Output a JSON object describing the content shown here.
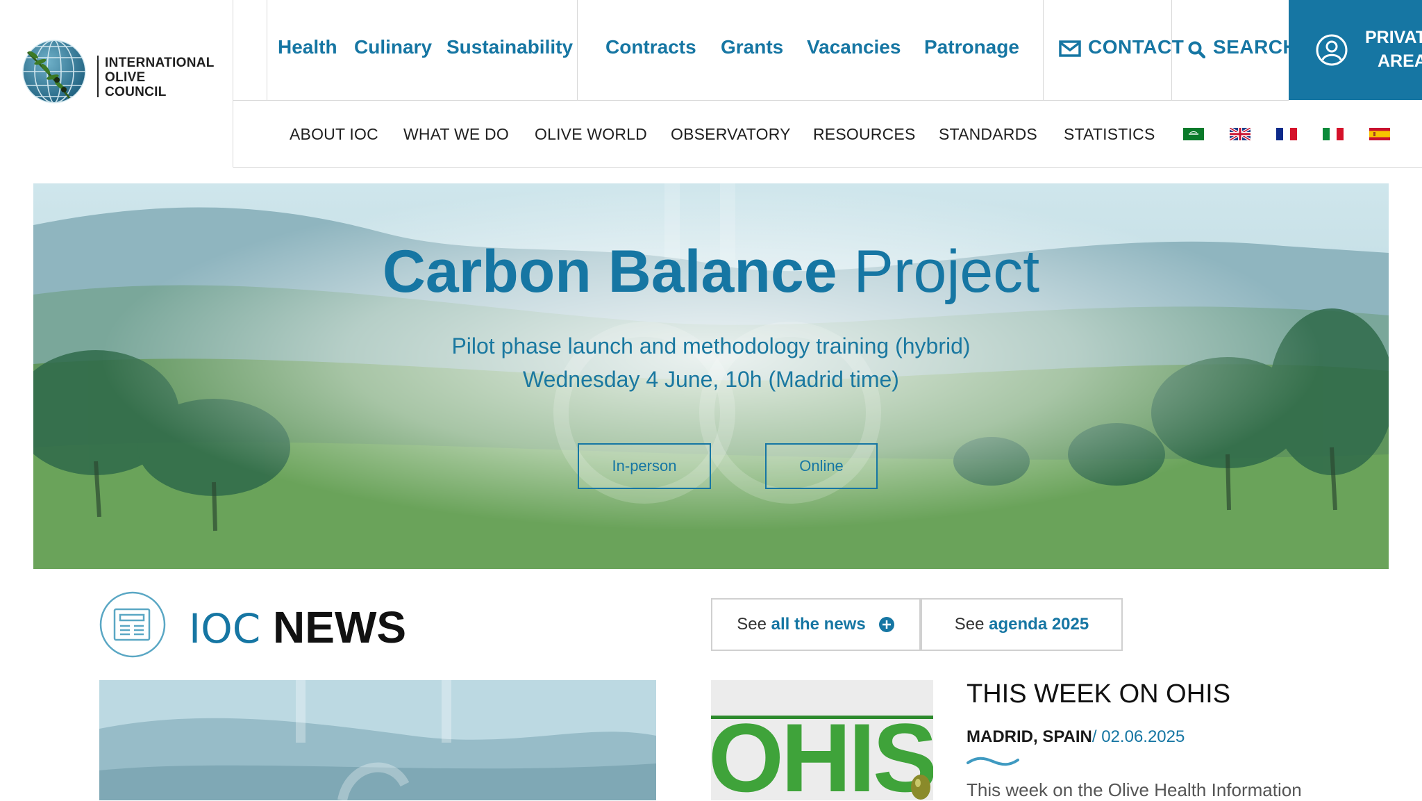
{
  "logo": {
    "line1": "INTERNATIONAL",
    "line2": "OLIVE",
    "line3": "COUNCIL"
  },
  "topbar": {
    "links_group1": [
      "Health",
      "Culinary",
      "Sustainability"
    ],
    "links_group2": [
      "Contracts",
      "Grants",
      "Vacancies",
      "Patronage"
    ],
    "contact": "CONTACT",
    "search": "SEARCH",
    "private_line1": "PRIVAT",
    "private_line2": "AREA"
  },
  "mainnav": {
    "items": [
      "ABOUT IOC",
      "WHAT WE DO",
      "OLIVE WORLD",
      "OBSERVATORY",
      "RESOURCES",
      "STANDARDS",
      "STATISTICS"
    ]
  },
  "hero": {
    "title_bold": "Carbon Balance",
    "title_light": "Project",
    "sub1": "Pilot phase launch and methodology training (hybrid)",
    "sub2": "Wednesday 4 June, 10h (Madrid time)",
    "btn_inperson": "In-person",
    "btn_online": "Online"
  },
  "news": {
    "title_light": "IOC",
    "title_bold": "NEWS",
    "see_all_prefix": "See",
    "see_all_hl": "all the news",
    "see_agenda_prefix": "See",
    "see_agenda_hl": "agenda 2025",
    "ohis_word": "OHIS",
    "headline": "THIS WEEK ON OHIS",
    "place": "MADRID, SPAIN",
    "date": "/ 02.06.2025",
    "excerpt": "This week on the Olive Health Information"
  },
  "colors": {
    "brand": "#1676a3",
    "olive_green": "#3fa33a"
  }
}
